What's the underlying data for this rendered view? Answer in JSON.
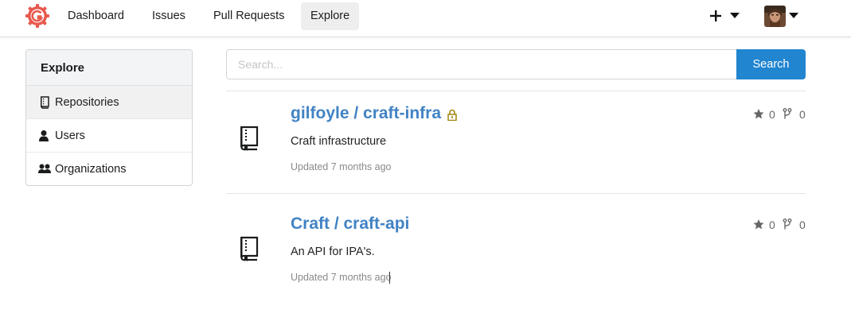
{
  "nav": {
    "items": [
      {
        "label": "Dashboard"
      },
      {
        "label": "Issues"
      },
      {
        "label": "Pull Requests"
      },
      {
        "label": "Explore"
      }
    ]
  },
  "sidebar": {
    "header": "Explore",
    "items": [
      {
        "label": "Repositories",
        "icon": "repo-icon",
        "active": true
      },
      {
        "label": "Users",
        "icon": "user-icon",
        "active": false
      },
      {
        "label": "Organizations",
        "icon": "organization-icon",
        "active": false
      }
    ]
  },
  "search": {
    "placeholder": "Search...",
    "value": "",
    "button_label": "Search"
  },
  "repos": [
    {
      "title": "gilfoyle / craft-infra",
      "private": true,
      "description": "Craft infrastructure",
      "updated": "Updated 7 months ago",
      "stars": "0",
      "forks": "0"
    },
    {
      "title": "Craft / craft-api",
      "private": false,
      "description": "An API for IPA's.",
      "updated": "Updated 7 months ago",
      "stars": "0",
      "forks": "0"
    }
  ],
  "colors": {
    "accent": "#2185d0",
    "link": "#4183c4",
    "logo": "#e8594e",
    "lock": "#a0870e"
  }
}
